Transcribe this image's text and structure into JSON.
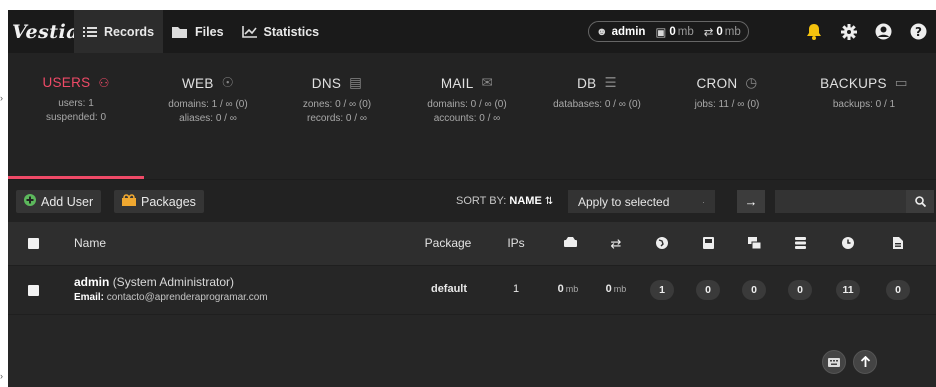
{
  "app": {
    "logo": "Vestia"
  },
  "nav": [
    {
      "label": "Records",
      "icon": "list-icon",
      "active": true
    },
    {
      "label": "Files",
      "icon": "folder-icon"
    },
    {
      "label": "Statistics",
      "icon": "chart-icon"
    }
  ],
  "user_pill": {
    "user": "admin",
    "disk_value": "0",
    "disk_unit": "mb",
    "bw_value": "0",
    "bw_unit": "mb"
  },
  "stats": [
    {
      "title": "USERS",
      "line1": "users: 1",
      "line2": "suspended: 0",
      "active": true
    },
    {
      "title": "WEB",
      "line1": "domains: 1 / ∞ (0)",
      "line2": "aliases: 0 / ∞"
    },
    {
      "title": "DNS",
      "line1": "zones: 0 / ∞ (0)",
      "line2": "records: 0 / ∞"
    },
    {
      "title": "MAIL",
      "line1": "domains: 0 / ∞ (0)",
      "line2": "accounts: 0 / ∞"
    },
    {
      "title": "DB",
      "line1": "databases: 0 / ∞ (0)",
      "line2": ""
    },
    {
      "title": "CRON",
      "line1": "jobs: 11 / ∞ (0)",
      "line2": ""
    },
    {
      "title": "BACKUPS",
      "line1": "backups: 0 / 1",
      "line2": ""
    }
  ],
  "toolbar": {
    "add_user": "Add User",
    "packages": "Packages",
    "sort_label": "SORT BY:",
    "sort_value": "NAME",
    "apply_selected": "Apply to selected"
  },
  "table": {
    "headers": {
      "name": "Name",
      "package": "Package",
      "ips": "IPs"
    },
    "rows": [
      {
        "username": "admin",
        "fullname": "(System Administrator)",
        "email_label": "Email:",
        "email": "contacto@aprenderaprogramar.com",
        "package": "default",
        "ips": "1",
        "disk_value": "0",
        "disk_unit": "mb",
        "bw_value": "0",
        "bw_unit": "mb",
        "web": "1",
        "dns": "0",
        "mail": "0",
        "db": "0",
        "cron": "11",
        "backups": "0"
      }
    ]
  }
}
